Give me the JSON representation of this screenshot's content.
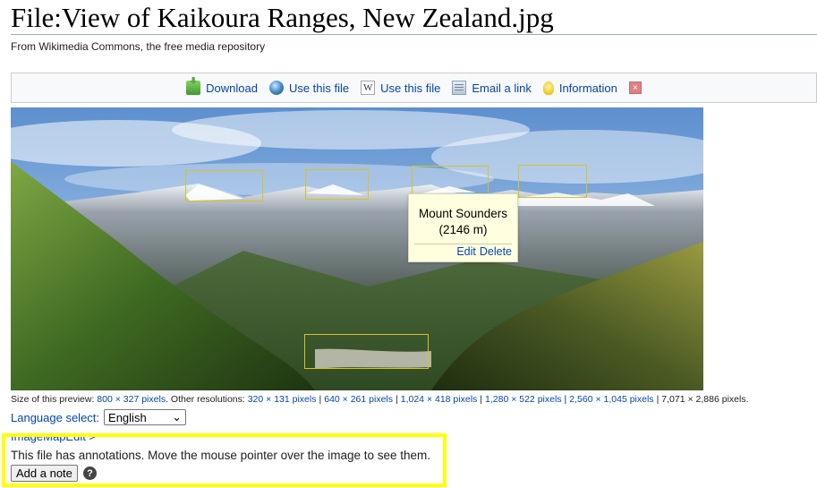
{
  "page": {
    "title": "File:View of Kaikoura Ranges, New Zealand.jpg",
    "subtitle": "From Wikimedia Commons, the free media repository"
  },
  "toolbar": {
    "download": "Download",
    "use_file_1": "Use this file",
    "use_file_2": "Use this file",
    "email": "Email a link",
    "information": "Information",
    "w_icon_text": "W",
    "close_icon_text": "×"
  },
  "annotation": {
    "title": "Mount Sounders",
    "subtitle": "(2146 m)",
    "edit": "Edit",
    "delete": "Delete"
  },
  "resolutions": {
    "prefix": "Size of this preview:",
    "preview": "800 × 327 pixels",
    "other_label": ". Other resolutions:",
    "links": [
      "320 × 131 pixels",
      "640 × 261 pixels",
      "1,024 × 418 pixels",
      "1,280 × 522 pixels",
      "2,560 × 1,045 pixels"
    ],
    "separator": "|",
    "original": "7,071 × 2,886 pixels."
  },
  "language": {
    "label": "Language select:",
    "selected": "English",
    "chevron": "⌄"
  },
  "notes_panel": {
    "cut_text": "ImageMapEdit >",
    "notice": "This file has annotations. Move the mouse pointer over the image to see them.",
    "add_button": "Add a note",
    "help": "?"
  },
  "colors": {
    "link": "#0645ad",
    "highlight": "#ffff00",
    "note_border": "#d6c322",
    "tooltip_bg": "#ffffe0"
  },
  "icons": [
    "download-icon",
    "globe-icon",
    "wikipedia-w-icon",
    "email-icon",
    "lightbulb-icon",
    "close-icon",
    "help-icon"
  ]
}
